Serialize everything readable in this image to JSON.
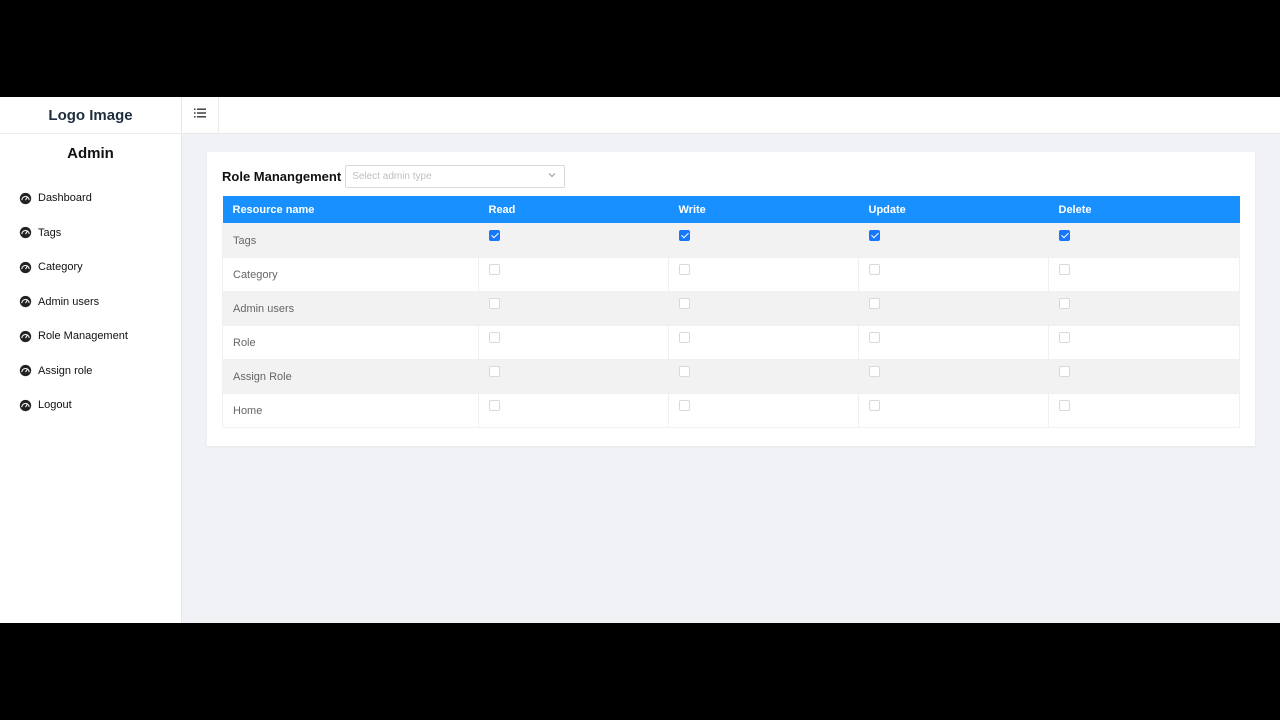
{
  "brand": {
    "logo_text": "Logo Image",
    "subtitle": "Admin"
  },
  "sidebar": {
    "items": [
      {
        "label": "Dashboard",
        "icon": "dashboard-icon"
      },
      {
        "label": "Tags",
        "icon": "dashboard-icon"
      },
      {
        "label": "Category",
        "icon": "dashboard-icon"
      },
      {
        "label": "Admin users",
        "icon": "dashboard-icon"
      },
      {
        "label": "Role Management",
        "icon": "dashboard-icon"
      },
      {
        "label": "Assign role",
        "icon": "dashboard-icon"
      },
      {
        "label": "Logout",
        "icon": "dashboard-icon"
      }
    ]
  },
  "topbar": {
    "menu_icon": "menu-unfold-icon"
  },
  "card": {
    "title": "Role Manangement",
    "select": {
      "placeholder": "Select admin type",
      "value": ""
    }
  },
  "table": {
    "headers": [
      "Resource name",
      "Read",
      "Write",
      "Update",
      "Delete"
    ],
    "rows": [
      {
        "name": "Tags",
        "read": true,
        "write": true,
        "update": true,
        "delete": true
      },
      {
        "name": "Category",
        "read": false,
        "write": false,
        "update": false,
        "delete": false
      },
      {
        "name": "Admin users",
        "read": false,
        "write": false,
        "update": false,
        "delete": false
      },
      {
        "name": "Role",
        "read": false,
        "write": false,
        "update": false,
        "delete": false
      },
      {
        "name": "Assign Role",
        "read": false,
        "write": false,
        "update": false,
        "delete": false
      },
      {
        "name": "Home",
        "read": false,
        "write": false,
        "update": false,
        "delete": false
      }
    ]
  },
  "colors": {
    "accent": "#1890ff",
    "checkbox": "#1677ff",
    "background": "#f0f2f5"
  }
}
